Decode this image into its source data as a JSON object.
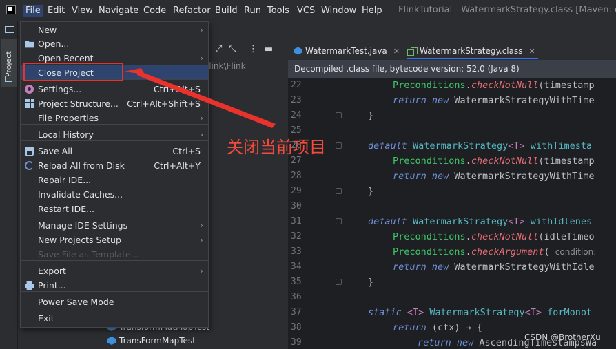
{
  "menubar": {
    "items": [
      "File",
      "Edit",
      "View",
      "Navigate",
      "Code",
      "Refactor",
      "Build",
      "Run",
      "Tools",
      "VCS",
      "Window",
      "Help"
    ],
    "active": "File"
  },
  "window_title": "FlinkTutorial - WatermarkStrategy.class [Maven: org.ap",
  "tool_strip": {
    "project_tab": "Project"
  },
  "project_pane": {
    "path_hint": "flink\\Flink",
    "tree_items": [
      "TransformFlatMapTest",
      "TransFormMapTest"
    ]
  },
  "tabs": [
    {
      "label": "WatermarkTest.java",
      "icon": "java-class-icon",
      "selected": false
    },
    {
      "label": "WatermarkStrategy.class",
      "icon": "class-file-icon",
      "selected": true
    }
  ],
  "banner": "Decompiled .class file, bytecode version: 52.0 (Java 8)",
  "file_menu": {
    "items": [
      {
        "label": "New",
        "shortcut": "",
        "submenu": true,
        "icon": "",
        "disabled": false
      },
      {
        "label": "Open...",
        "shortcut": "",
        "submenu": false,
        "icon": "folder-icon",
        "disabled": false
      },
      {
        "label": "Open Recent",
        "shortcut": "",
        "submenu": true,
        "icon": "",
        "disabled": false
      },
      {
        "label": "Close Project",
        "shortcut": "",
        "submenu": false,
        "icon": "",
        "disabled": false
      },
      {
        "label": "Settings...",
        "shortcut": "Ctrl+Alt+S",
        "submenu": false,
        "icon": "gear-icon",
        "disabled": false
      },
      {
        "label": "Project Structure...",
        "shortcut": "Ctrl+Alt+Shift+S",
        "submenu": false,
        "icon": "grid-icon",
        "disabled": false
      },
      {
        "label": "File Properties",
        "shortcut": "",
        "submenu": true,
        "icon": "",
        "disabled": false
      },
      {
        "label": "Local History",
        "shortcut": "",
        "submenu": true,
        "icon": "",
        "disabled": false
      },
      {
        "label": "Save All",
        "shortcut": "Ctrl+S",
        "submenu": false,
        "icon": "save-icon",
        "disabled": false
      },
      {
        "label": "Reload All from Disk",
        "shortcut": "Ctrl+Alt+Y",
        "submenu": false,
        "icon": "reload-icon",
        "disabled": false
      },
      {
        "label": "Repair IDE...",
        "shortcut": "",
        "submenu": false,
        "icon": "",
        "disabled": false
      },
      {
        "label": "Invalidate Caches...",
        "shortcut": "",
        "submenu": false,
        "icon": "",
        "disabled": false
      },
      {
        "label": "Restart IDE...",
        "shortcut": "",
        "submenu": false,
        "icon": "",
        "disabled": false
      },
      {
        "label": "Manage IDE Settings",
        "shortcut": "",
        "submenu": true,
        "icon": "",
        "disabled": false
      },
      {
        "label": "New Projects Setup",
        "shortcut": "",
        "submenu": true,
        "icon": "",
        "disabled": false
      },
      {
        "label": "Save File as Template...",
        "shortcut": "",
        "submenu": false,
        "icon": "",
        "disabled": true
      },
      {
        "label": "Export",
        "shortcut": "",
        "submenu": true,
        "icon": "",
        "disabled": false
      },
      {
        "label": "Print...",
        "shortcut": "",
        "submenu": false,
        "icon": "print-icon",
        "disabled": false
      },
      {
        "label": "Power Save Mode",
        "shortcut": "",
        "submenu": false,
        "icon": "",
        "disabled": false
      },
      {
        "label": "Exit",
        "shortcut": "",
        "submenu": false,
        "icon": "",
        "disabled": false
      }
    ]
  },
  "annotation": {
    "text": "关闭当前项目",
    "color": "#f24a3c"
  },
  "watermark": "CSDN @BrotherXu",
  "editor": {
    "lines": [
      {
        "n": "22",
        "code": [
          [
            "pre",
            "Preconditions"
          ],
          [
            "",
            "."
          ],
          [
            "mt",
            "checkNotNull"
          ],
          [
            "",
            "(timestamp"
          ]
        ],
        "indent": 2
      },
      {
        "n": "23",
        "code": [
          [
            "kw",
            "return "
          ],
          [
            "kw",
            "new "
          ],
          [
            "",
            "WatermarkStrategyWithTime"
          ]
        ],
        "indent": 2
      },
      {
        "n": "24",
        "code": [
          [
            "",
            "}"
          ]
        ],
        "indent": 1
      },
      {
        "n": "25",
        "code": [],
        "indent": 0
      },
      {
        "n": "26",
        "code": [
          [
            "kw",
            "default "
          ],
          [
            "ty",
            "WatermarkStrategy"
          ],
          [
            "gen",
            "<T>"
          ],
          [
            "ty",
            " withTimesta"
          ]
        ],
        "indent": 1
      },
      {
        "n": "27",
        "code": [
          [
            "pre",
            "Preconditions"
          ],
          [
            "",
            "."
          ],
          [
            "mt",
            "checkNotNull"
          ],
          [
            "",
            "(timestamp"
          ]
        ],
        "indent": 2
      },
      {
        "n": "28",
        "code": [
          [
            "kw",
            "return "
          ],
          [
            "kw",
            "new "
          ],
          [
            "",
            "WatermarkStrategyWithTime"
          ]
        ],
        "indent": 2
      },
      {
        "n": "29",
        "code": [
          [
            "",
            "}"
          ]
        ],
        "indent": 1
      },
      {
        "n": "30",
        "code": [],
        "indent": 0
      },
      {
        "n": "31",
        "code": [
          [
            "kw",
            "default "
          ],
          [
            "ty",
            "WatermarkStrategy"
          ],
          [
            "gen",
            "<T>"
          ],
          [
            "ty",
            " withIdlenes"
          ]
        ],
        "indent": 1
      },
      {
        "n": "32",
        "code": [
          [
            "pre",
            "Preconditions"
          ],
          [
            "",
            "."
          ],
          [
            "mt",
            "checkNotNull"
          ],
          [
            "",
            "(idleTimeo"
          ]
        ],
        "indent": 2
      },
      {
        "n": "33",
        "code": [
          [
            "pre",
            "Preconditions"
          ],
          [
            "",
            "."
          ],
          [
            "mt",
            "checkArgument"
          ],
          [
            "",
            "( "
          ],
          [
            "hint",
            "condition: "
          ]
        ],
        "indent": 2
      },
      {
        "n": "34",
        "code": [
          [
            "kw",
            "return "
          ],
          [
            "kw",
            "new "
          ],
          [
            "",
            "WatermarkStrategyWithIdle"
          ]
        ],
        "indent": 2
      },
      {
        "n": "35",
        "code": [
          [
            "",
            "}"
          ]
        ],
        "indent": 1
      },
      {
        "n": "36",
        "code": [],
        "indent": 0
      },
      {
        "n": "37",
        "code": [
          [
            "kw",
            "static "
          ],
          [
            "gen",
            "<T> "
          ],
          [
            "ty",
            "WatermarkStrategy"
          ],
          [
            "gen",
            "<T>"
          ],
          [
            "ty",
            " forMonot"
          ]
        ],
        "indent": 1
      },
      {
        "n": "38",
        "code": [
          [
            "kw",
            "return "
          ],
          [
            "",
            "(ctx) → {"
          ]
        ],
        "indent": 2
      },
      {
        "n": "39",
        "code": [
          [
            "kw",
            "return "
          ],
          [
            "kw",
            "new "
          ],
          [
            "",
            "AscendingTimestampsWa"
          ]
        ],
        "indent": 3
      }
    ]
  }
}
